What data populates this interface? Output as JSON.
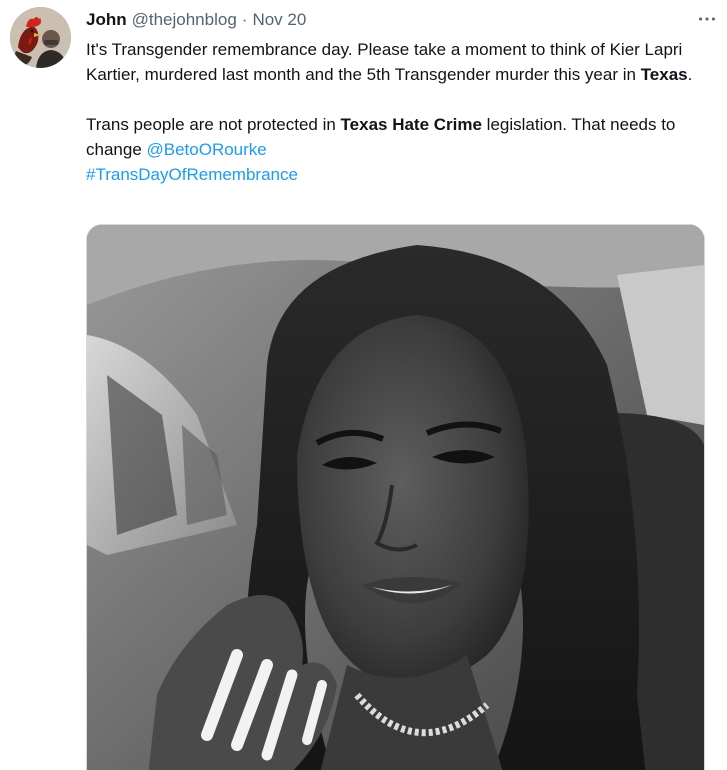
{
  "tweet": {
    "author_name": "John",
    "author_handle": "@thejohnblog",
    "separator": "·",
    "timestamp": "Nov 20",
    "more_icon": "more-horizontal-icon",
    "paragraph1": {
      "text_a": "It's Transgender remembrance day. Please take a moment to think of Kier Lapri Kartier, murdered last month and the 5th Transgender murder this year in ",
      "bold_a": "Texas",
      "text_b": "."
    },
    "paragraph2": {
      "text_a": "Trans people are not protected in ",
      "bold_a": "Texas Hate Crime",
      "text_b": " legislation. That needs to change ",
      "mention": "@BetoORourke",
      "hashtag": "#TransDayOfRemembrance"
    },
    "colors": {
      "link": "#1d9bf0",
      "text": "#0f1419",
      "secondary": "#536471",
      "border": "#cfd9de"
    }
  }
}
